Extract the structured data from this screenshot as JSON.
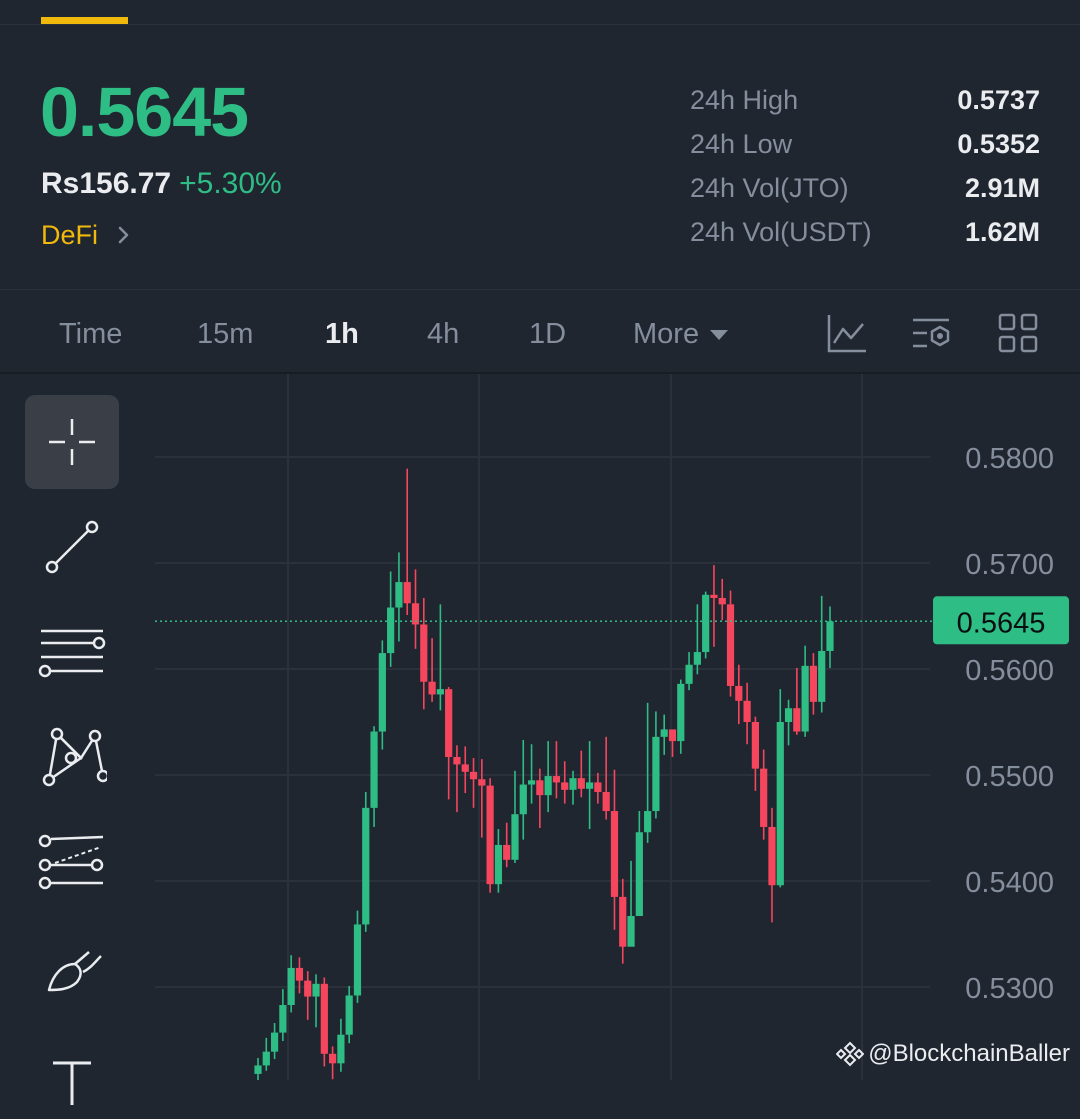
{
  "header": {
    "last_price": "0.5645",
    "fiat_price": "Rs156.77",
    "change_percent": "+5.30%",
    "tag": "DeFi"
  },
  "stats": [
    {
      "label": "24h High",
      "value": "0.5737"
    },
    {
      "label": "24h Low",
      "value": "0.5352"
    },
    {
      "label": "24h Vol(JTO)",
      "value": "2.91M"
    },
    {
      "label": "24h Vol(USDT)",
      "value": "1.62M"
    }
  ],
  "timeframes": {
    "time": "Time",
    "m15": "15m",
    "h1": "1h",
    "h4": "4h",
    "d1": "1D",
    "more": "More",
    "active": "1h"
  },
  "toolbar_icons": [
    "indicator-icon",
    "chart-settings-icon",
    "layout-grid-icon"
  ],
  "drawing_tools": [
    "crosshair-icon",
    "trend-line-icon",
    "horizontal-lines-icon",
    "pattern-icon",
    "fib-channel-icon",
    "brush-icon",
    "text-icon"
  ],
  "colors": {
    "up": "#2ebd85",
    "down": "#f6465d",
    "accent": "#f0b90b",
    "background": "#1f2630"
  },
  "watermark": "@BlockchainBaller",
  "chart_data": {
    "type": "candlestick",
    "y_ticks": [
      "0.5800",
      "0.5700",
      "0.5600",
      "0.5500",
      "0.5400",
      "0.5300"
    ],
    "ylim": [
      0.525,
      0.585
    ],
    "last_price_label": "0.5645",
    "last_price": 0.5645,
    "grid": true,
    "candles": [
      [
        0.5218,
        0.5226,
        0.5208,
        0.5233
      ],
      [
        0.5226,
        0.5239,
        0.5221,
        0.5252
      ],
      [
        0.5239,
        0.5257,
        0.5232,
        0.5266
      ],
      [
        0.5257,
        0.5283,
        0.5249,
        0.5298
      ],
      [
        0.5283,
        0.5318,
        0.5276,
        0.533
      ],
      [
        0.5318,
        0.5306,
        0.5294,
        0.5328
      ],
      [
        0.5306,
        0.5291,
        0.5269,
        0.5315
      ],
      [
        0.5291,
        0.5303,
        0.5262,
        0.5312
      ],
      [
        0.5303,
        0.5237,
        0.5225,
        0.5309
      ],
      [
        0.5237,
        0.5228,
        0.5213,
        0.5244
      ],
      [
        0.5228,
        0.5255,
        0.522,
        0.527
      ],
      [
        0.5255,
        0.5292,
        0.5247,
        0.5301
      ],
      [
        0.5292,
        0.5359,
        0.5285,
        0.5372
      ],
      [
        0.5359,
        0.5469,
        0.5352,
        0.5484
      ],
      [
        0.5469,
        0.5541,
        0.5451,
        0.5546
      ],
      [
        0.5541,
        0.5615,
        0.5524,
        0.5627
      ],
      [
        0.5615,
        0.5658,
        0.5602,
        0.5692
      ],
      [
        0.5658,
        0.5682,
        0.5626,
        0.571
      ],
      [
        0.5682,
        0.5662,
        0.5651,
        0.5789
      ],
      [
        0.5662,
        0.5642,
        0.5619,
        0.5694
      ],
      [
        0.5642,
        0.5588,
        0.5562,
        0.5667
      ],
      [
        0.5588,
        0.5576,
        0.5569,
        0.5629
      ],
      [
        0.5576,
        0.5581,
        0.5561,
        0.5661
      ],
      [
        0.5581,
        0.5517,
        0.5477,
        0.5583
      ],
      [
        0.5517,
        0.551,
        0.5465,
        0.5528
      ],
      [
        0.551,
        0.5503,
        0.5483,
        0.5527
      ],
      [
        0.5503,
        0.5496,
        0.5469,
        0.5516
      ],
      [
        0.5496,
        0.549,
        0.5441,
        0.5515
      ],
      [
        0.549,
        0.5397,
        0.5389,
        0.5497
      ],
      [
        0.5397,
        0.5434,
        0.5389,
        0.5449
      ],
      [
        0.5434,
        0.542,
        0.5413,
        0.5455
      ],
      [
        0.542,
        0.5463,
        0.5417,
        0.5504
      ],
      [
        0.5463,
        0.5491,
        0.5439,
        0.5533
      ],
      [
        0.5491,
        0.5495,
        0.5473,
        0.5529
      ],
      [
        0.5495,
        0.5481,
        0.545,
        0.5506
      ],
      [
        0.5481,
        0.5499,
        0.5465,
        0.5532
      ],
      [
        0.5499,
        0.5493,
        0.5478,
        0.5532
      ],
      [
        0.5493,
        0.5486,
        0.5473,
        0.5513
      ],
      [
        0.5486,
        0.5497,
        0.5472,
        0.5504
      ],
      [
        0.5497,
        0.5487,
        0.5479,
        0.5523
      ],
      [
        0.5487,
        0.5493,
        0.5449,
        0.5532
      ],
      [
        0.5493,
        0.5484,
        0.5473,
        0.5502
      ],
      [
        0.5484,
        0.5466,
        0.5458,
        0.5536
      ],
      [
        0.5466,
        0.5385,
        0.5354,
        0.5505
      ],
      [
        0.5385,
        0.5338,
        0.5322,
        0.5402
      ],
      [
        0.5338,
        0.5367,
        0.5339,
        0.5419
      ],
      [
        0.5367,
        0.5446,
        0.5369,
        0.5466
      ],
      [
        0.5446,
        0.5466,
        0.5436,
        0.5568
      ],
      [
        0.5466,
        0.5536,
        0.5459,
        0.556
      ],
      [
        0.5536,
        0.5543,
        0.5519,
        0.5557
      ],
      [
        0.5543,
        0.5532,
        0.5517,
        0.5541
      ],
      [
        0.5532,
        0.5586,
        0.552,
        0.559
      ],
      [
        0.5586,
        0.5604,
        0.558,
        0.5616
      ],
      [
        0.5604,
        0.5616,
        0.5595,
        0.5661
      ],
      [
        0.5616,
        0.567,
        0.561,
        0.5673
      ],
      [
        0.567,
        0.5667,
        0.5621,
        0.5698
      ],
      [
        0.5667,
        0.5661,
        0.5646,
        0.5685
      ],
      [
        0.5661,
        0.5584,
        0.5574,
        0.5674
      ],
      [
        0.5584,
        0.557,
        0.5548,
        0.5604
      ],
      [
        0.557,
        0.555,
        0.5529,
        0.5587
      ],
      [
        0.555,
        0.5506,
        0.5485,
        0.5555
      ],
      [
        0.5506,
        0.5451,
        0.5439,
        0.5524
      ],
      [
        0.5451,
        0.5396,
        0.5361,
        0.5469
      ],
      [
        0.5396,
        0.555,
        0.5394,
        0.5581
      ],
      [
        0.555,
        0.5563,
        0.5528,
        0.5571
      ],
      [
        0.5563,
        0.5541,
        0.5538,
        0.5601
      ],
      [
        0.5541,
        0.5603,
        0.5536,
        0.5622
      ],
      [
        0.5603,
        0.5569,
        0.5557,
        0.5615
      ],
      [
        0.5569,
        0.5617,
        0.5559,
        0.5669
      ],
      [
        0.5617,
        0.5645,
        0.5601,
        0.5659
      ]
    ]
  }
}
